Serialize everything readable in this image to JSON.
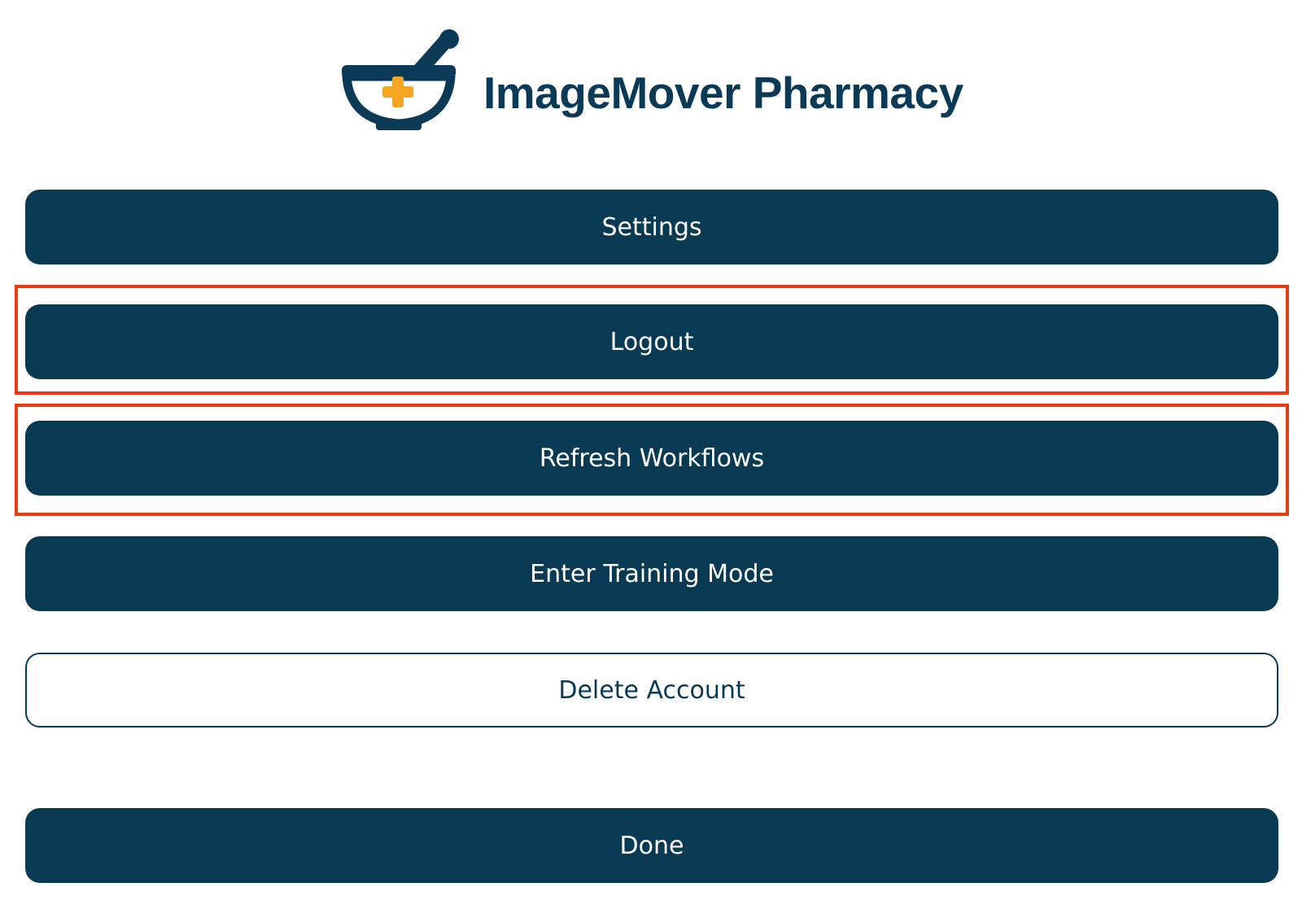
{
  "header": {
    "logo_icon": "mortar-pestle-cross-icon",
    "title": "ImageMover Pharmacy"
  },
  "colors": {
    "primary": "#083a54",
    "accent_cross": "#f5a623",
    "highlight": "#e83b12",
    "background": "#ffffff"
  },
  "menu": {
    "settings_label": "Settings",
    "logout_label": "Logout",
    "refresh_workflows_label": "Refresh Workflows",
    "training_mode_label": "Enter Training Mode",
    "delete_account_label": "Delete Account",
    "done_label": "Done"
  }
}
